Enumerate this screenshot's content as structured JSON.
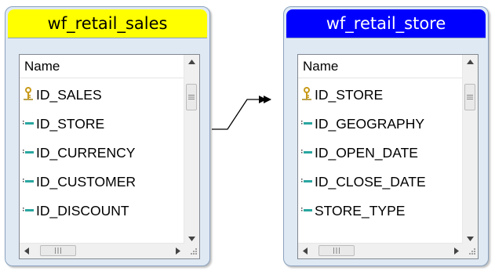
{
  "tables": [
    {
      "title": "wf_retail_sales",
      "title_bg": "#ffff00",
      "title_color": "#000000",
      "column_header": "Name",
      "fields": [
        {
          "name": "ID_SALES",
          "icon": "primary-key-icon"
        },
        {
          "name": "ID_STORE",
          "icon": "column-icon"
        },
        {
          "name": "ID_CURRENCY",
          "icon": "column-icon"
        },
        {
          "name": "ID_CUSTOMER",
          "icon": "column-icon"
        },
        {
          "name": "ID_DISCOUNT",
          "icon": "column-icon"
        }
      ]
    },
    {
      "title": "wf_retail_store",
      "title_bg": "#0000ff",
      "title_color": "#ffffff",
      "column_header": "Name",
      "fields": [
        {
          "name": "ID_STORE",
          "icon": "primary-key-icon"
        },
        {
          "name": "ID_GEOGRAPHY",
          "icon": "column-icon"
        },
        {
          "name": "ID_OPEN_DATE",
          "icon": "column-icon"
        },
        {
          "name": "ID_CLOSE_DATE",
          "icon": "column-icon"
        },
        {
          "name": "STORE_TYPE",
          "icon": "column-icon"
        }
      ]
    }
  ],
  "connector": {
    "icon": "join-arrow-icon"
  }
}
